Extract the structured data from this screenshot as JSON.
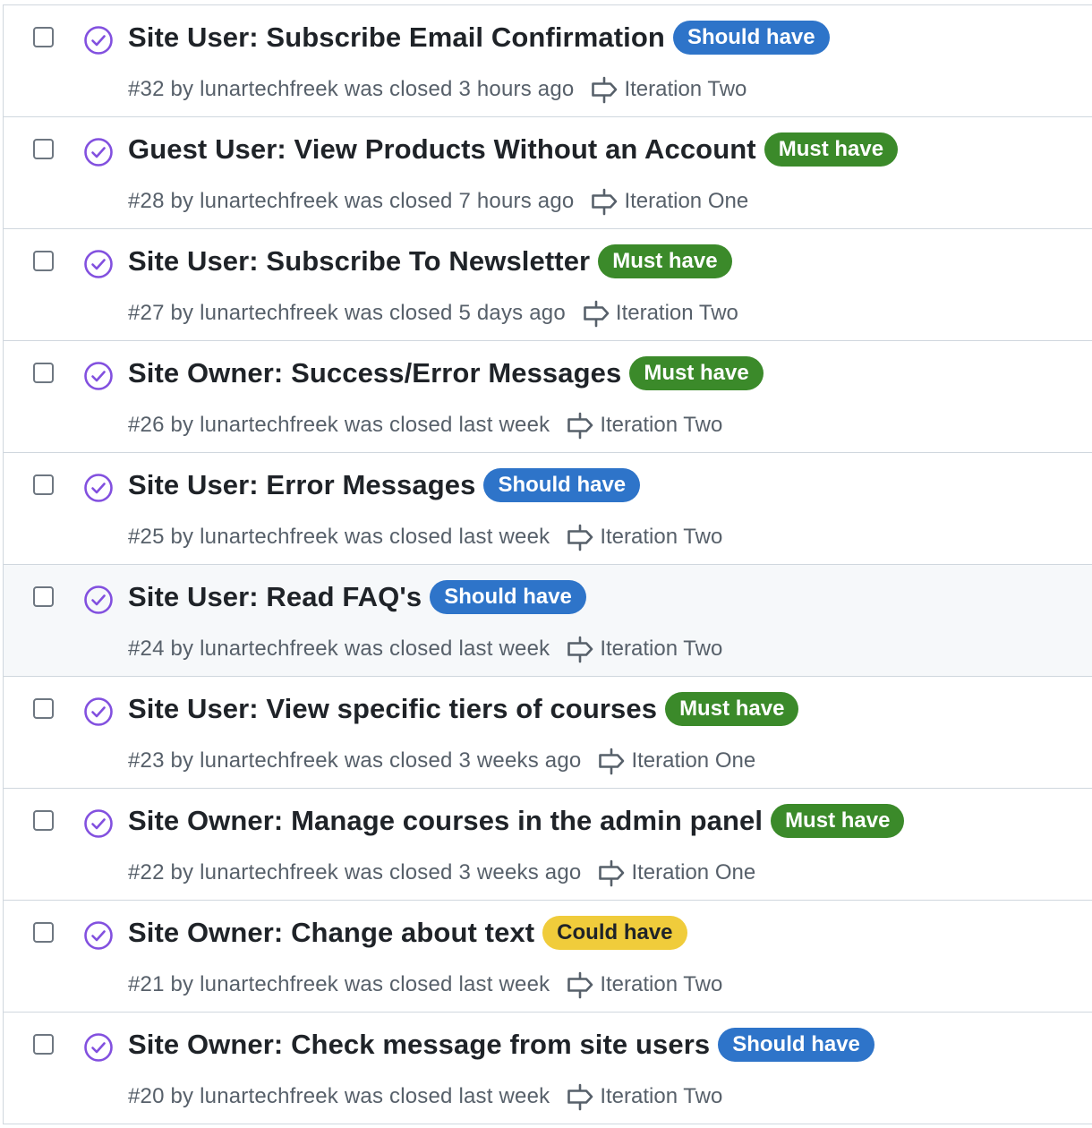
{
  "colors": {
    "closed_icon": "#8250df",
    "border": "#d0d7de",
    "muted_text": "#57606a",
    "title_text": "#1f2328"
  },
  "label_styles": {
    "Should have": {
      "bg": "#2e74c9",
      "fg": "#ffffff"
    },
    "Must have": {
      "bg": "#3b8a2a",
      "fg": "#ffffff"
    },
    "Could have": {
      "bg": "#f0cc3b",
      "fg": "#1f2328"
    }
  },
  "issues": [
    {
      "title": "Site User: Subscribe Email Confirmation",
      "label": "Should have",
      "meta": "#32 by lunartechfreek was closed 3 hours ago",
      "milestone": "Iteration Two"
    },
    {
      "title": "Guest User: View Products Without an Account",
      "label": "Must have",
      "meta": "#28 by lunartechfreek was closed 7 hours ago",
      "milestone": "Iteration One"
    },
    {
      "title": "Site User: Subscribe To Newsletter",
      "label": "Must have",
      "meta": "#27 by lunartechfreek was closed 5 days ago",
      "milestone": "Iteration Two"
    },
    {
      "title": "Site Owner: Success/Error Messages",
      "label": "Must have",
      "meta": "#26 by lunartechfreek was closed last week",
      "milestone": "Iteration Two"
    },
    {
      "title": "Site User: Error Messages",
      "label": "Should have",
      "meta": "#25 by lunartechfreek was closed last week",
      "milestone": "Iteration Two"
    },
    {
      "title": "Site User: Read FAQ's",
      "label": "Should have",
      "meta": "#24 by lunartechfreek was closed last week",
      "milestone": "Iteration Two",
      "highlighted": true
    },
    {
      "title": "Site User: View specific tiers of courses",
      "label": "Must have",
      "meta": "#23 by lunartechfreek was closed 3 weeks ago",
      "milestone": "Iteration One"
    },
    {
      "title": "Site Owner: Manage courses in the admin panel",
      "label": "Must have",
      "meta": "#22 by lunartechfreek was closed 3 weeks ago",
      "milestone": "Iteration One"
    },
    {
      "title": "Site Owner: Change about text",
      "label": "Could have",
      "meta": "#21 by lunartechfreek was closed last week",
      "milestone": "Iteration Two"
    },
    {
      "title": "Site Owner: Check message from site users",
      "label": "Should have",
      "meta": "#20 by lunartechfreek was closed last week",
      "milestone": "Iteration Two"
    }
  ]
}
